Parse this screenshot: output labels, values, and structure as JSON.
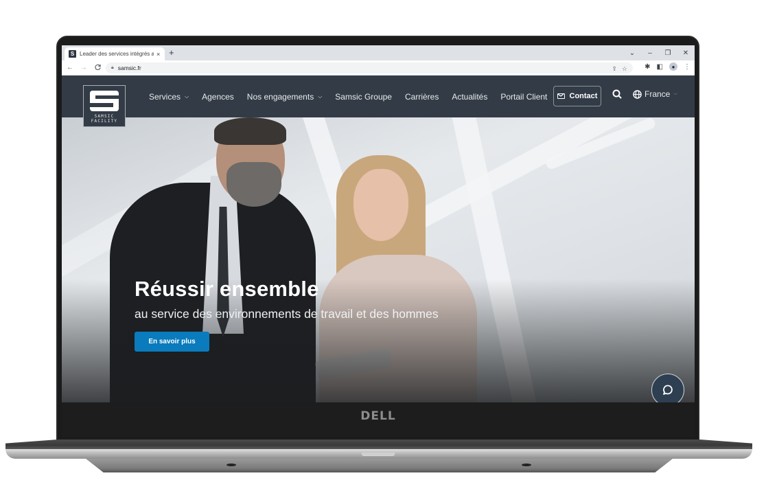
{
  "device": {
    "brand_logo": "DELL"
  },
  "browser": {
    "tab": {
      "title": "Leader des services intégrés aux",
      "favicon": "samsic-favicon-icon",
      "close_icon": "×"
    },
    "new_tab_icon": "+",
    "window_controls": {
      "tab_search": "⌄",
      "minimize": "–",
      "restore": "❐",
      "close": "✕"
    },
    "nav": {
      "back": "←",
      "forward": "→",
      "reload": "C"
    },
    "address": {
      "url": "samsic.fr",
      "lock_icon": "lock-icon"
    },
    "omnibox_icons": [
      "share-icon",
      "star-icon"
    ],
    "extension_icons": [
      "puzzle-icon",
      "side-panel-icon",
      "profile-icon",
      "menu-icon"
    ]
  },
  "site": {
    "logo": {
      "line1": "SAMSIC",
      "line2": "FACILITY"
    },
    "nav": [
      {
        "label": "Services",
        "has_dropdown": true
      },
      {
        "label": "Agences",
        "has_dropdown": false
      },
      {
        "label": "Nos engagements",
        "has_dropdown": true
      },
      {
        "label": "Samsic Groupe",
        "has_dropdown": false
      },
      {
        "label": "Carrières",
        "has_dropdown": false
      },
      {
        "label": "Actualités",
        "has_dropdown": false
      },
      {
        "label": "Portail Client",
        "has_dropdown": false
      }
    ],
    "contact_label": "Contact",
    "language": "France",
    "hero": {
      "title": "Réussir ensemble",
      "subtitle": "au service des environnements de travail et des hommes",
      "cta_label": "En savoir plus"
    },
    "colors": {
      "header_bg": "#333c46",
      "cta_blue": "#0a7bbd",
      "chat_bg": "#2f3f52"
    }
  }
}
